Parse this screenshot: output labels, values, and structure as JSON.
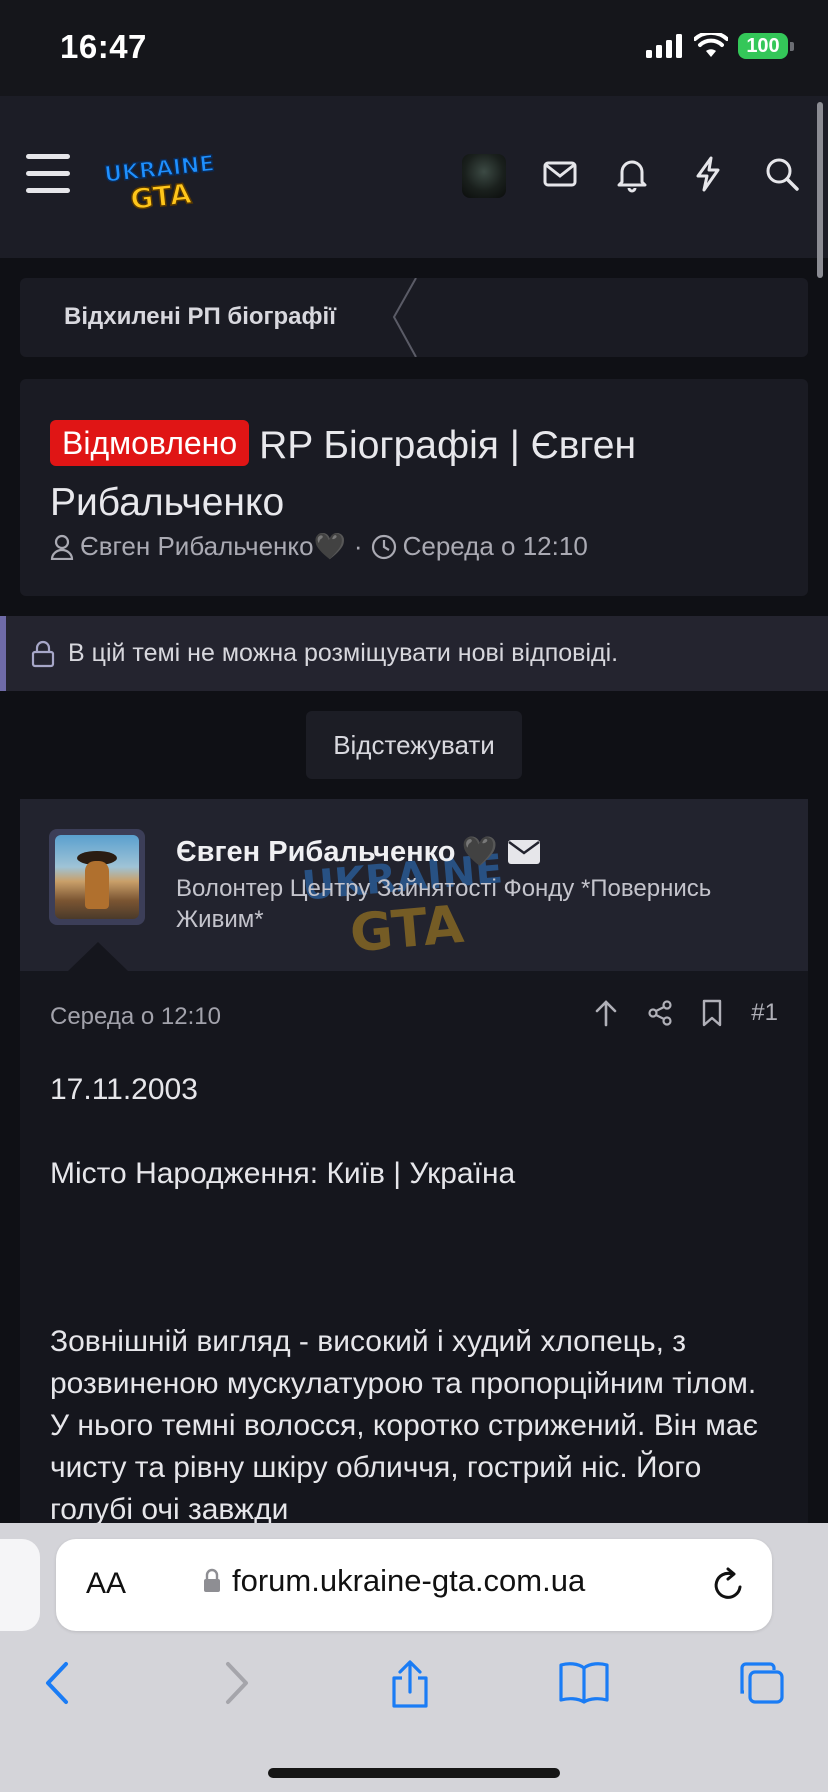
{
  "status_bar": {
    "time": "16:47",
    "battery": "100"
  },
  "header": {
    "logo_alt": "UKRAINE GTA"
  },
  "breadcrumb": {
    "label": "Відхилені РП біографії"
  },
  "thread": {
    "label": "Відмовлено",
    "title": "RP Біографія | Євген Рибальченко",
    "author": "Євген Рибальченко",
    "author_emoji": "🖤",
    "separator": "·",
    "date": "Середа о 12:10"
  },
  "locked_notice": "В цій темі не можна розміщувати нові відповіді.",
  "watch_button": "Відстежувати",
  "post": {
    "username": "Євген Рибальченко",
    "username_emoji": "🖤",
    "user_title": "Волонтер Центру Зайнятості Фонду *Повернись Живим*",
    "date": "Середа о 12:10",
    "number": "#1",
    "lines": {
      "dob": "17.11.2003",
      "birthplace": "Місто Народження: Київ | Україна",
      "appearance": "Зовнішній вигляд - високий і худий хлопець, з розвиненою мускулатурою та пропорційним тілом. У нього темні волосся, коротко стрижений. Він має чисту та рівну шкіру обличчя, гострий ніс. Його голубі очі завжди"
    }
  },
  "browser": {
    "aa_label": "AA",
    "url": "forum.ukraine-gta.com.ua"
  },
  "colors": {
    "badge_red": "#e01515",
    "locked_accent": "#6f6ba8",
    "battery_green": "#34c759"
  }
}
